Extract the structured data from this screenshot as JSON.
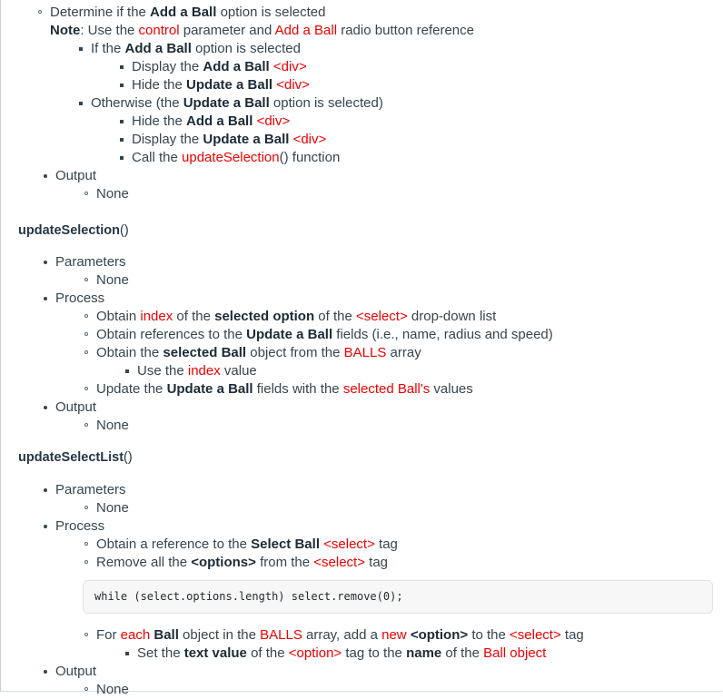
{
  "document": {
    "type": "technical-specification",
    "colors": {
      "body_text": "#36454f",
      "bold_text": "#1c2b36",
      "code_reference": "#ee0000",
      "code_block_bg": "#f7f7f8",
      "code_block_border": "#dfe2e5",
      "page_border": "#c8d0d4"
    }
  },
  "sections": [
    {
      "id": "continued-section",
      "heading": null,
      "items": {
        "determine": {
          "text_1": "Determine if the ",
          "bold_1": "Add a Ball",
          "text_2": " option is selected",
          "note_label": "Note",
          "note_text_1": ": Use the ",
          "note_code_1": "control",
          "note_text_2": " parameter and ",
          "note_code_2": "Add a Ball",
          "note_text_3": " radio button reference"
        },
        "if_branch": {
          "text_1": "If the ",
          "bold_1": "Add a Ball",
          "text_2": " option is selected",
          "children": [
            {
              "text_1": "Display the ",
              "bold_1": "Add a Ball",
              "text_2": " ",
              "code_1": "<div>"
            },
            {
              "text_1": "Hide the ",
              "bold_1": "Update a Ball",
              "text_2": " ",
              "code_1": "<div>"
            }
          ]
        },
        "else_branch": {
          "text_1": "Otherwise (the ",
          "bold_1": "Update a Ball",
          "text_2": " option is selected)",
          "children": [
            {
              "text_1": "Hide the ",
              "bold_1": "Add a Ball",
              "text_2": " ",
              "code_1": "<div>"
            },
            {
              "text_1": "Display the ",
              "bold_1": "Update a Ball",
              "text_2": " ",
              "code_1": "<div>"
            },
            {
              "text_1": "Call the ",
              "code_1": "updateSelection",
              "text_2": "() function"
            }
          ]
        },
        "output_label": "Output",
        "output_value": "None"
      }
    },
    {
      "id": "update-selection",
      "heading_name": "updateSelection",
      "heading_paren": "()",
      "parameters_label": "Parameters",
      "parameters_value": "None",
      "process_label": "Process",
      "process_items": [
        {
          "text_1": "Obtain ",
          "code_1": "index",
          "text_2": " of the ",
          "bold_1": "selected option",
          "text_3": " of the ",
          "code_2": "<select>",
          "text_4": " drop-down list"
        },
        {
          "text_1": "Obtain references to the ",
          "bold_1": "Update a Ball",
          "text_2": " fields (i.e., name, radius and speed)"
        },
        {
          "text_1": "Obtain the ",
          "bold_1": "selected Ball",
          "text_2": " object from the ",
          "code_1": "BALLS",
          "text_3": " array",
          "children": [
            {
              "text_1": "Use the ",
              "code_1": "index",
              "text_2": " value"
            }
          ]
        },
        {
          "text_1": "Update the ",
          "bold_1": "Update a Ball",
          "text_2": " fields with the ",
          "code_1": "selected Ball's",
          "text_3": " values"
        }
      ],
      "output_label": "Output",
      "output_value": "None"
    },
    {
      "id": "update-select-list",
      "heading_name": "updateSelectList",
      "heading_paren": "()",
      "parameters_label": "Parameters",
      "parameters_value": "None",
      "process_label": "Process",
      "process_items": [
        {
          "text_1": "Obtain a reference to the ",
          "bold_1": "Select Ball",
          "text_2": " ",
          "code_1": "<select>",
          "text_3": " tag"
        },
        {
          "text_1": "Remove all the ",
          "bold_1": "<options>",
          "text_2": " from the ",
          "code_1": "<select>",
          "text_3": " tag"
        }
      ],
      "code_snippet": "while (select.options.length) select.remove(0);",
      "process_items_after_code": [
        {
          "text_1": "For ",
          "code_1": "each",
          "text_2": " ",
          "bold_1": "Ball",
          "text_3": " object in the ",
          "code_2": "BALLS",
          "text_4": " array, add a ",
          "code_3": "new",
          "text_5": " ",
          "bold_2": "<option>",
          "text_6": " to the ",
          "code_4": "<select>",
          "text_7": " tag",
          "children": [
            {
              "text_1": "Set the ",
              "bold_1": "text value",
              "text_2": " of the ",
              "code_1": "<option>",
              "text_3": " tag to the ",
              "bold_2": "name",
              "text_4": " of the ",
              "code_2": "Ball object"
            }
          ]
        }
      ],
      "output_label": "Output",
      "output_value": "None"
    }
  ]
}
